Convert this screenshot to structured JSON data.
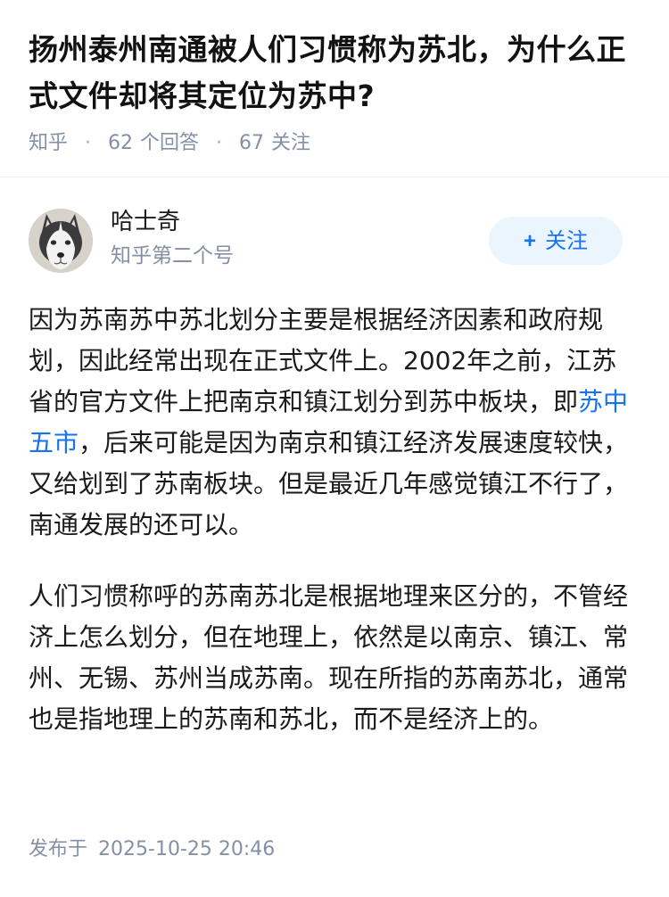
{
  "question": {
    "title": "扬州泰州南通被人们习惯称为苏北，为什么正式文件却将其定位为苏中?",
    "source": "知乎",
    "separator": "·",
    "answers_count": "62",
    "answers_label": "个回答",
    "followers_count": "67",
    "followers_label": "关注"
  },
  "author": {
    "name": "哈士奇",
    "headline": "知乎第二个号",
    "avatar_icon": "husky-avatar",
    "follow_label": "关注",
    "follow_prefix": "+"
  },
  "answer": {
    "p1_before_link": "因为苏南苏中苏北划分主要是根据经济因素和政府规划，因此经常出现在正式文件上。2002年之前，江苏省的官方文件上把南京和镇江划分到苏中板块，即",
    "p1_link": "苏中五市",
    "p1_after_link": "，后来可能是因为南京和镇江经济发展速度较快，又给划到了苏南板块。但是最近几年感觉镇江不行了，南通发展的还可以。",
    "p2": "人们习惯称呼的苏南苏北是根据地理来区分的，不管经济上怎么划分，但在地理上，依然是以南京、镇江、常州、无锡、苏州当成苏南。现在所指的苏南苏北，通常也是指地理上的苏南和苏北，而不是经济上的。"
  },
  "footer": {
    "publish_label": "发布于",
    "publish_time": "2025-10-25 20:46"
  },
  "colors": {
    "link": "#1772f6",
    "meta": "#8590a6",
    "follow_bg": "#ebf5fd"
  }
}
